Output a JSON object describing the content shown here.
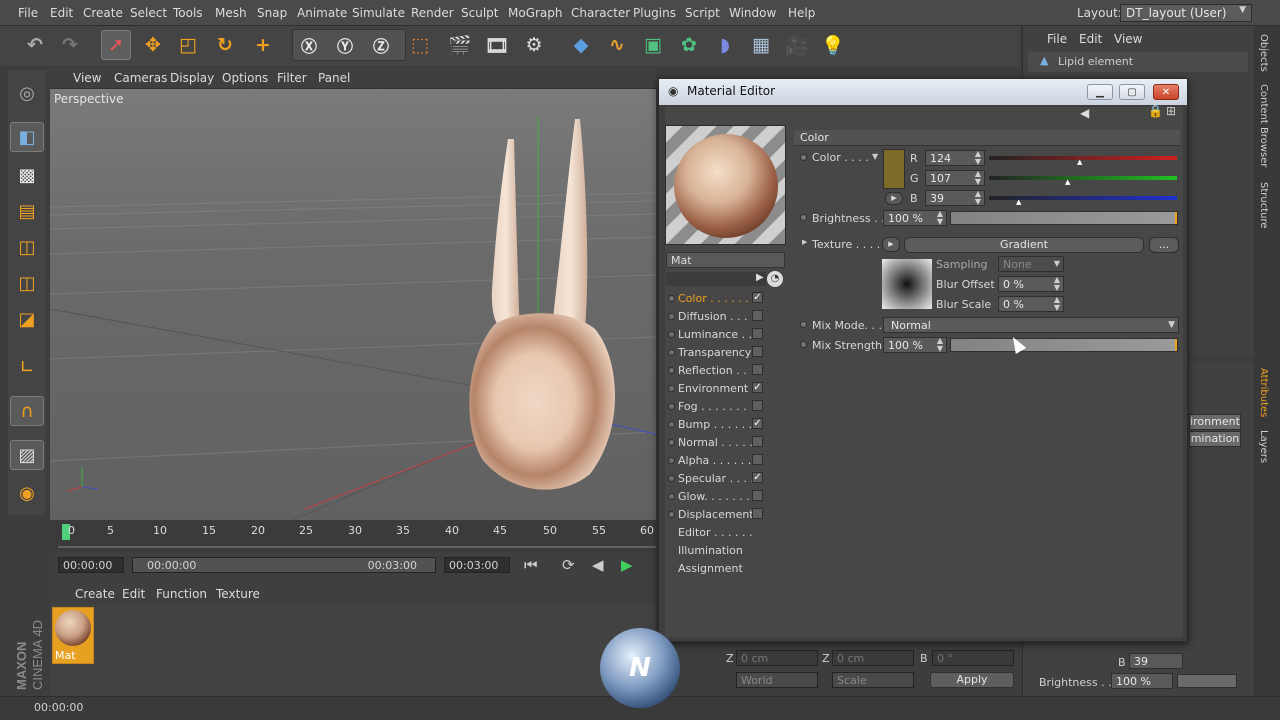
{
  "menubar": {
    "items": [
      "File",
      "Edit",
      "Create",
      "Select",
      "Tools",
      "Mesh",
      "Snap",
      "Animate",
      "Simulate",
      "Render",
      "Sculpt",
      "MoGraph",
      "Character",
      "Plugins",
      "Script",
      "Window",
      "Help"
    ],
    "layout_label": "Layout:",
    "layout_value": "DT_layout (User)"
  },
  "viewport": {
    "menu": [
      "View",
      "Cameras",
      "Display",
      "Options",
      "Filter",
      "Panel"
    ],
    "label": "Perspective"
  },
  "timeline": {
    "ticks": [
      "0",
      "5",
      "10",
      "15",
      "20",
      "25",
      "30",
      "35",
      "40",
      "45",
      "50",
      "55",
      "60"
    ],
    "current_time": "00:00:00",
    "start_field": "00:00:00",
    "end_field": "00:03:00",
    "range_end": "00:03:00",
    "max_time": "00:03:00"
  },
  "material_manager": {
    "menu": [
      "Create",
      "Edit",
      "Function",
      "Texture"
    ],
    "material_name": "Mat"
  },
  "status": {
    "time": "00:00:00"
  },
  "object_panel": {
    "menu": [
      "File",
      "Edit",
      "View"
    ],
    "object_name": "Lipid element"
  },
  "side_tabs": [
    "Objects",
    "Content Browser",
    "Structure",
    "Attributes",
    "Layers"
  ],
  "attr_panel": {
    "tab1": "ironment",
    "tab2": "mination",
    "b_label": "B",
    "b_value": "39",
    "brightness_label": "Brightness . .",
    "brightness_value": "100 %"
  },
  "coords": {
    "z_label": "Z",
    "z_pos": "0 cm",
    "z2_label": "Z",
    "z_size": "0 cm",
    "b_label": "B",
    "b_rot": "0 °",
    "world": "World",
    "scale": "Scale",
    "apply": "Apply"
  },
  "material_editor": {
    "title": "Material Editor",
    "material_name": "Mat",
    "channels": [
      {
        "label": "Color . . . . . .",
        "checked": "✓"
      },
      {
        "label": "Diffusion . . .",
        "checked": ""
      },
      {
        "label": "Luminance . . .",
        "checked": ""
      },
      {
        "label": "Transparency",
        "checked": ""
      },
      {
        "label": "Reflection . .",
        "checked": ""
      },
      {
        "label": "Environment",
        "checked": "✓"
      },
      {
        "label": "Fog . . . . . . .",
        "checked": ""
      },
      {
        "label": "Bump . . . . . .",
        "checked": "✓"
      },
      {
        "label": "Normal . . . . .",
        "checked": ""
      },
      {
        "label": "Alpha . . . . . .",
        "checked": ""
      },
      {
        "label": "Specular . . . .",
        "checked": "✓"
      },
      {
        "label": "Glow. . . . . . .",
        "checked": ""
      },
      {
        "label": "Displacement",
        "checked": ""
      }
    ],
    "extra_channels": [
      "Editor . . . . . .",
      "Illumination",
      "Assignment"
    ],
    "section": "Color",
    "color_label": "Color . . . .",
    "swatch": "#7c6b27",
    "r_label": "R",
    "r_value": "124",
    "g_label": "G",
    "g_value": "107",
    "b_label": "B",
    "b_value": "39",
    "brightness_label": "Brightness . .",
    "brightness_value": "100 %",
    "texture_label": "Texture . . . . .",
    "texture_name": "Gradient",
    "texture_more": "...",
    "sampling_label": "Sampling",
    "sampling_value": "None",
    "blur_offset_label": "Blur Offset",
    "blur_offset_value": "0 %",
    "blur_scale_label": "Blur Scale",
    "blur_scale_value": "0 %",
    "mix_mode_label": "Mix Mode. . .",
    "mix_mode_value": "Normal",
    "mix_strength_label": "Mix Strength",
    "mix_strength_value": "100 %"
  },
  "colors": {
    "accent": "#f0a020",
    "swatch": "#7c6b27"
  }
}
